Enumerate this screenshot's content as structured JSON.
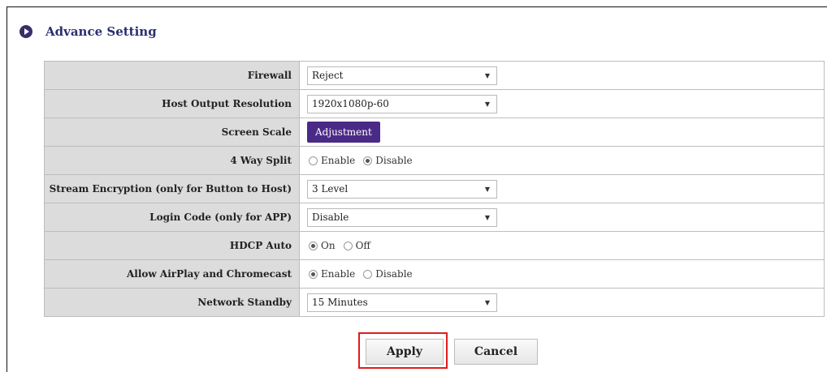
{
  "section": {
    "title": "Advance Setting"
  },
  "settings": [
    {
      "label": "Firewall",
      "type": "select",
      "value": "Reject"
    },
    {
      "label": "Host Output Resolution",
      "type": "select",
      "value": "1920x1080p-60"
    },
    {
      "label": "Screen Scale",
      "type": "button",
      "value": "Adjustment"
    },
    {
      "label": "4 Way Split",
      "type": "radio",
      "options": [
        "Enable",
        "Disable"
      ],
      "selected": "Disable"
    },
    {
      "label": "Stream Encryption (only for Button to Host)",
      "type": "select",
      "value": "3 Level"
    },
    {
      "label": "Login Code (only for APP)",
      "type": "select",
      "value": "Disable"
    },
    {
      "label": "HDCP Auto",
      "type": "radio",
      "options": [
        "On",
        "Off"
      ],
      "selected": "On"
    },
    {
      "label": "Allow AirPlay and Chromecast",
      "type": "radio",
      "options": [
        "Enable",
        "Disable"
      ],
      "selected": "Enable"
    },
    {
      "label": "Network Standby",
      "type": "select",
      "value": "15 Minutes"
    }
  ],
  "actions": {
    "apply_label": "Apply",
    "cancel_label": "Cancel"
  },
  "colors": {
    "header_icon": "#3a2d6a",
    "title": "#2b2f70",
    "label_bg": "#dcdcdc",
    "adjust_button": "#4a2a87",
    "highlight": "#e01c1c"
  }
}
